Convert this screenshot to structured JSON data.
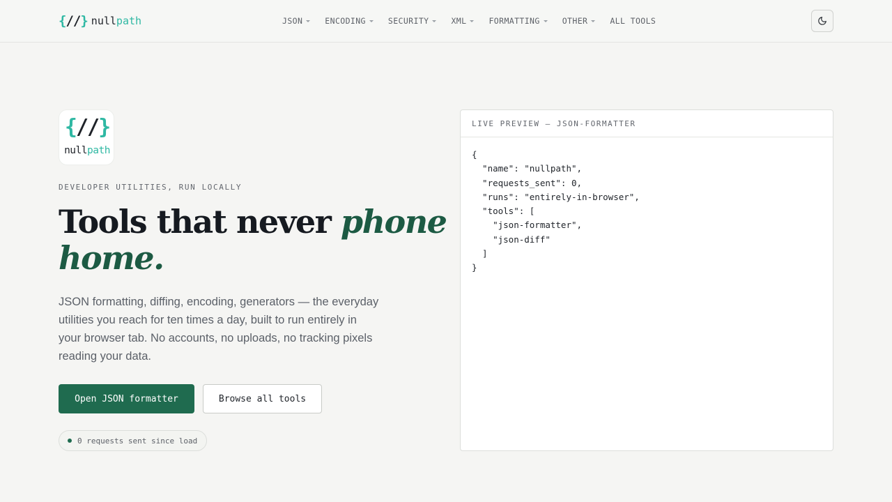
{
  "brand": {
    "mark_open": "{",
    "mark_slash": "//",
    "mark_close": "}",
    "name_part1": "null",
    "name_part2": "path"
  },
  "nav": {
    "items": [
      {
        "label": "JSON",
        "has_dropdown": true
      },
      {
        "label": "ENCODING",
        "has_dropdown": true
      },
      {
        "label": "SECURITY",
        "has_dropdown": true
      },
      {
        "label": "XML",
        "has_dropdown": true
      },
      {
        "label": "FORMATTING",
        "has_dropdown": true
      },
      {
        "label": "OTHER",
        "has_dropdown": true
      },
      {
        "label": "ALL TOOLS",
        "has_dropdown": false
      }
    ],
    "theme_toggle_icon": "moon-icon"
  },
  "hero": {
    "logo": {
      "braces_open": "{",
      "slash": "//",
      "braces_close": "}",
      "word_part1": "null",
      "word_part2": "path"
    },
    "eyebrow": "DEVELOPER UTILITIES, RUN LOCALLY",
    "headline_plain": "Tools that never ",
    "headline_accent": "phone home.",
    "lede": "JSON formatting, diffing, encoding, generators — the everyday utilities you reach for ten times a day, built to run entirely in your browser tab. No accounts, no uploads, no tracking pixels reading your data.",
    "primary_button": "Open JSON formatter",
    "secondary_button": "Browse all tools",
    "status_pill": "0 requests sent since load"
  },
  "preview": {
    "title": "LIVE PREVIEW — JSON-FORMATTER",
    "code": "{\n  \"name\": \"nullpath\",\n  \"requests_sent\": 0,\n  \"runs\": \"entirely-in-browser\",\n  \"tools\": [\n    \"json-formatter\",\n    \"json-diff\"\n  ]\n}"
  },
  "colors": {
    "accent_teal": "#2fb8a3",
    "accent_green": "#1f6b4f",
    "headline_accent": "#1c5a43",
    "background": "#f5f5f3"
  }
}
